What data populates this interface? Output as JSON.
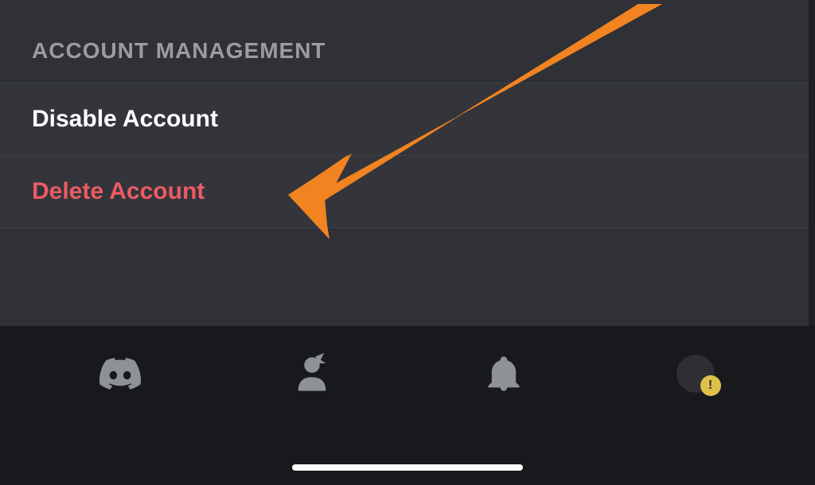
{
  "section": {
    "header": "ACCOUNT MANAGEMENT",
    "items": [
      {
        "label": "Disable Account",
        "danger": false
      },
      {
        "label": "Delete Account",
        "danger": true
      }
    ]
  },
  "nav": {
    "items": [
      {
        "name": "discord-logo-icon"
      },
      {
        "name": "friends-icon"
      },
      {
        "name": "notifications-bell-icon"
      },
      {
        "name": "profile-icon"
      }
    ],
    "badge": "!"
  }
}
